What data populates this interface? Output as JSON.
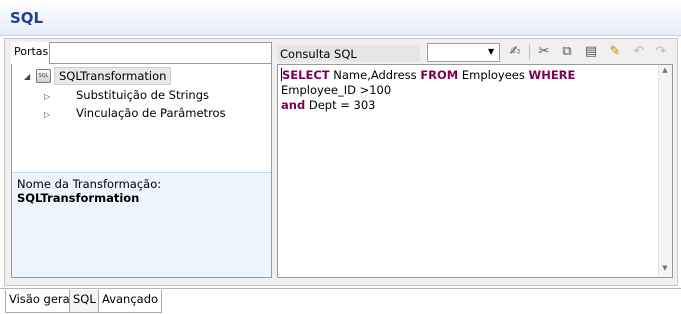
{
  "header": {
    "title": "SQL"
  },
  "left_panel": {
    "tab_label": "Portas",
    "tree": {
      "root_label": "SQLTransformation",
      "root_icon": "sql-database-icon",
      "children": [
        {
          "label": "Substituição de Strings"
        },
        {
          "label": "Vinculação de Parâmetros"
        }
      ]
    },
    "properties": {
      "label": "Nome da Transformação:",
      "value": "SQLTransformation"
    }
  },
  "sql_panel": {
    "label": "Consulta SQL",
    "dropdown_value": "",
    "query_tokens": [
      {
        "t": "SELECT",
        "kw": true
      },
      {
        "t": " Name,Address ",
        "kw": false
      },
      {
        "t": "FROM",
        "kw": true
      },
      {
        "t": " Employees ",
        "kw": false
      },
      {
        "t": "WHERE",
        "kw": true
      },
      {
        "t": " Employee_ID >100",
        "kw": false
      },
      {
        "t": "\n",
        "kw": false
      },
      {
        "t": "and",
        "kw": true
      },
      {
        "t": " Dept = 303",
        "kw": false
      }
    ],
    "toolbar_icons": [
      "validate-icon",
      "cut-icon",
      "copy-icon",
      "paste-icon",
      "edit-query-icon",
      "undo-icon",
      "redo-icon"
    ]
  },
  "bottom_tabs": [
    {
      "label": "Visão geral"
    },
    {
      "label": "SQL",
      "active": true
    },
    {
      "label": "Avançado"
    }
  ],
  "colors": {
    "title": "#1f3f8f",
    "keyword": "#7b0052",
    "properties_bg": "#eef4fc"
  }
}
